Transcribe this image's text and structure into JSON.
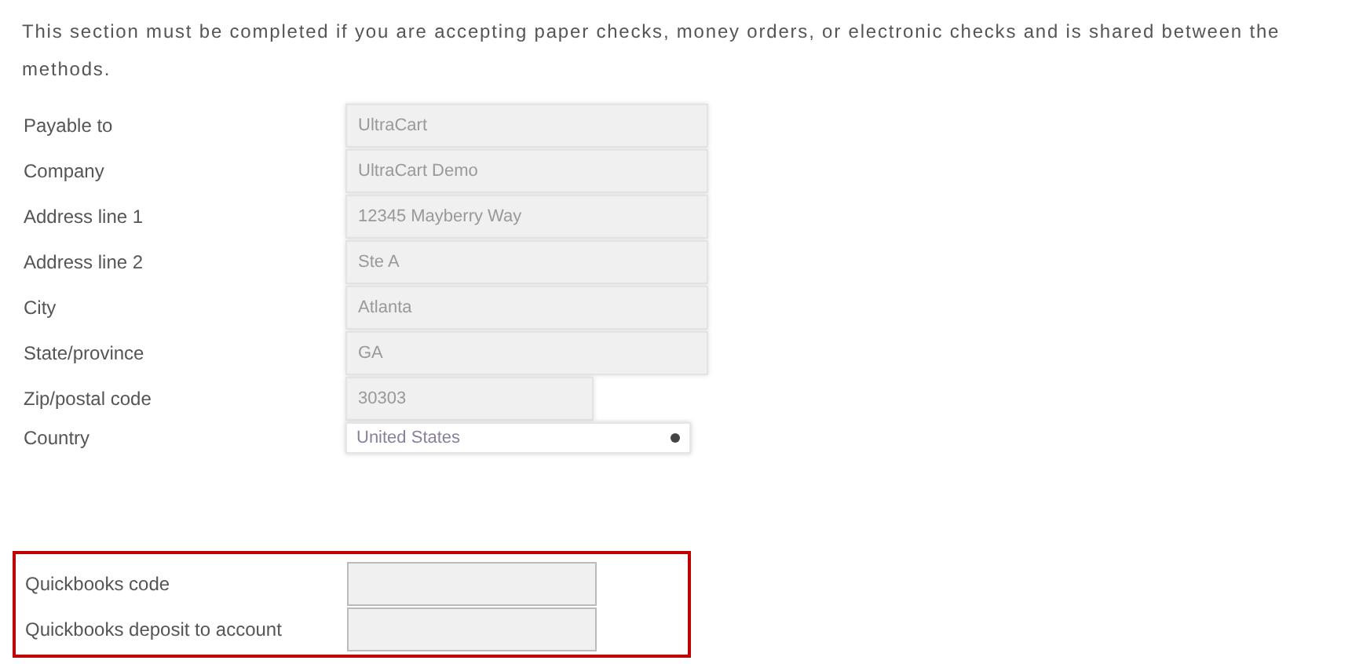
{
  "intro": "This section must be completed if you are accepting paper checks, money orders, or electronic checks and is shared between the methods.",
  "fields": [
    {
      "label": "Payable to",
      "kind": "text",
      "value": "UltraCart"
    },
    {
      "label": "Company",
      "kind": "text",
      "value": "UltraCart Demo"
    },
    {
      "label": "Address line 1",
      "kind": "text",
      "value": "12345 Mayberry Way"
    },
    {
      "label": "Address line 2",
      "kind": "text",
      "value": "Ste A"
    },
    {
      "label": "City",
      "kind": "text",
      "value": "Atlanta"
    },
    {
      "label": "State/province",
      "kind": "text",
      "value": "GA"
    },
    {
      "label": "Zip/postal code",
      "kind": "short",
      "value": "30303"
    },
    {
      "label": "Country",
      "kind": "select",
      "value": "United States"
    }
  ],
  "quickbooks": {
    "highlighted": true,
    "fields": [
      {
        "label": "Quickbooks code"
      },
      {
        "label": "Quickbooks deposit to account"
      }
    ]
  }
}
